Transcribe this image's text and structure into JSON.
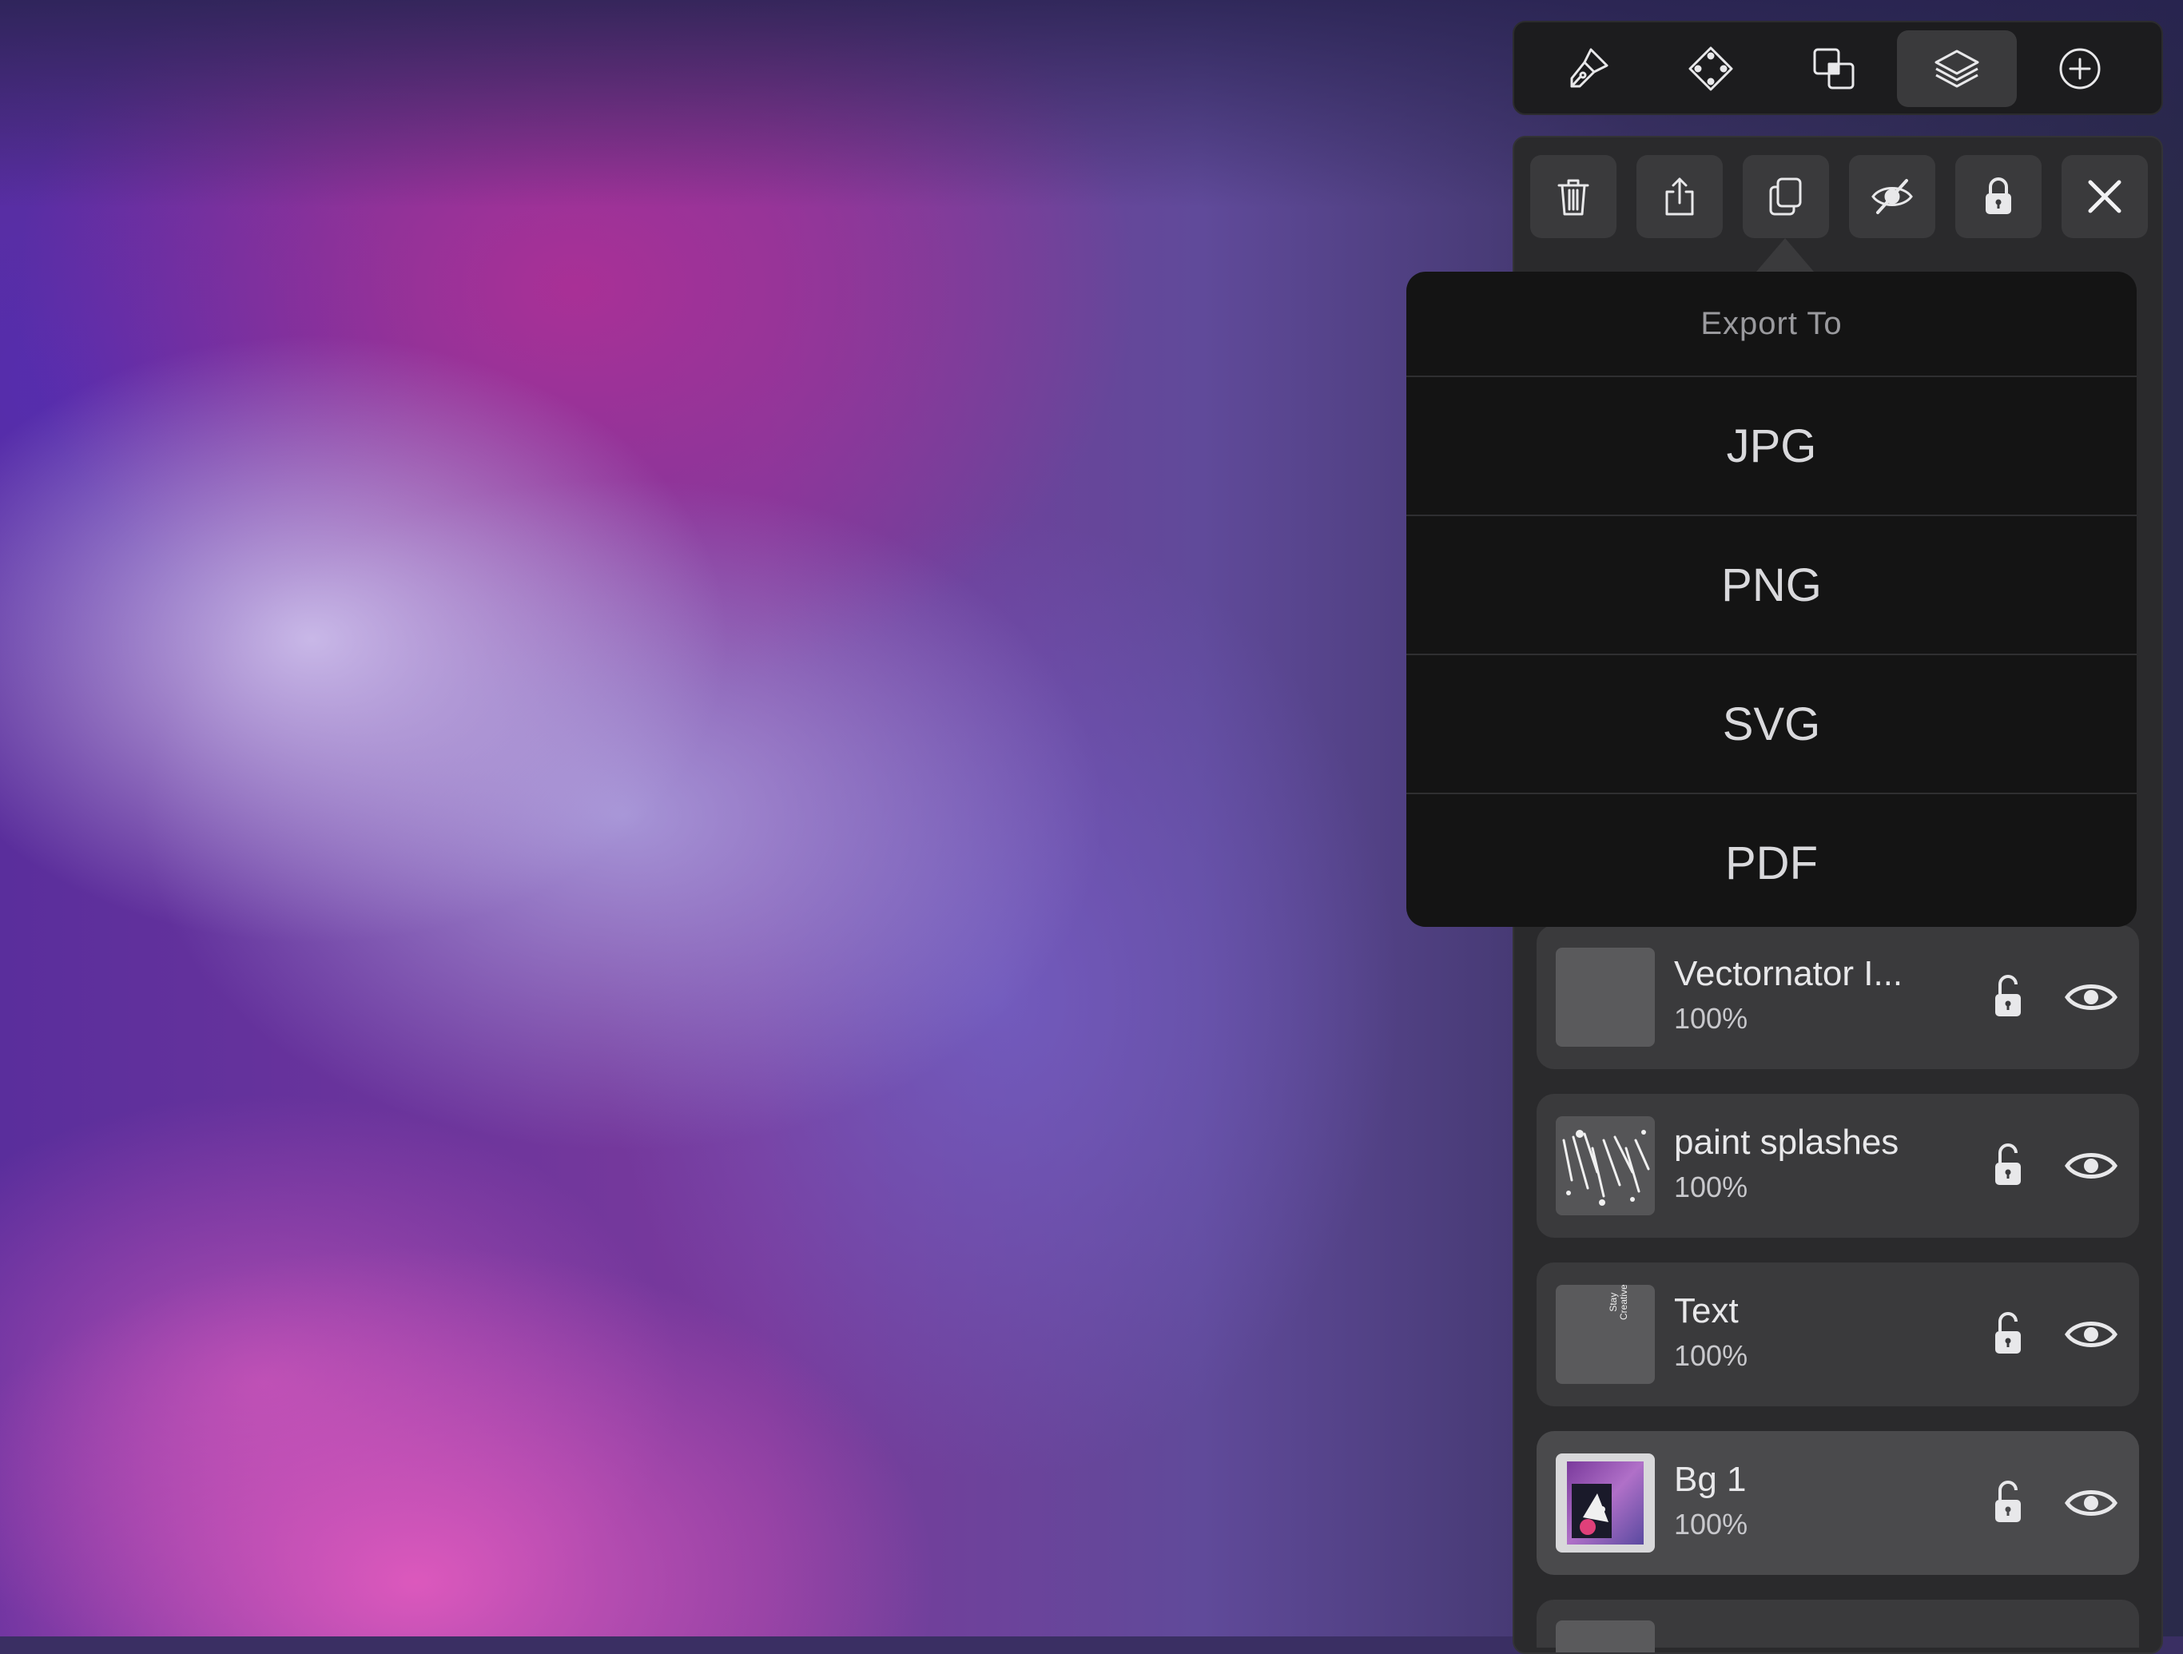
{
  "top_toolbar": {
    "tools": [
      {
        "icon": "pen-brush-icon",
        "active": false
      },
      {
        "icon": "node-select-icon",
        "active": false
      },
      {
        "icon": "arrange-shapes-icon",
        "active": false
      },
      {
        "icon": "layers-icon",
        "active": true
      },
      {
        "icon": "add-circle-icon",
        "active": false
      }
    ]
  },
  "layer_actions": [
    {
      "icon": "trash-icon"
    },
    {
      "icon": "share-export-icon"
    },
    {
      "icon": "duplicate-icon"
    },
    {
      "icon": "hide-eye-slash-icon"
    },
    {
      "icon": "lock-icon"
    },
    {
      "icon": "close-icon"
    }
  ],
  "export_menu": {
    "title": "Export To",
    "options": [
      "JPG",
      "PNG",
      "SVG",
      "PDF"
    ]
  },
  "layers": [
    {
      "name": "Vectornator I...",
      "opacity": "100%",
      "thumbnail": "blank-gray",
      "selected": false
    },
    {
      "name": "paint splashes",
      "opacity": "100%",
      "thumbnail": "paint-splashes",
      "selected": false
    },
    {
      "name": "Text",
      "opacity": "100%",
      "thumbnail": "text-stay-creative",
      "selected": false
    },
    {
      "name": "Bg 1",
      "opacity": "100%",
      "thumbnail": "background-art",
      "selected": true
    }
  ],
  "thumbnail_text": {
    "text_layer": [
      "Stay",
      "Creative"
    ]
  },
  "colors": {
    "panel": "#2a2a2c",
    "popover": "#141414",
    "layer_row": "#3a3a3c",
    "layer_row_selected": "#4a4a4c"
  }
}
